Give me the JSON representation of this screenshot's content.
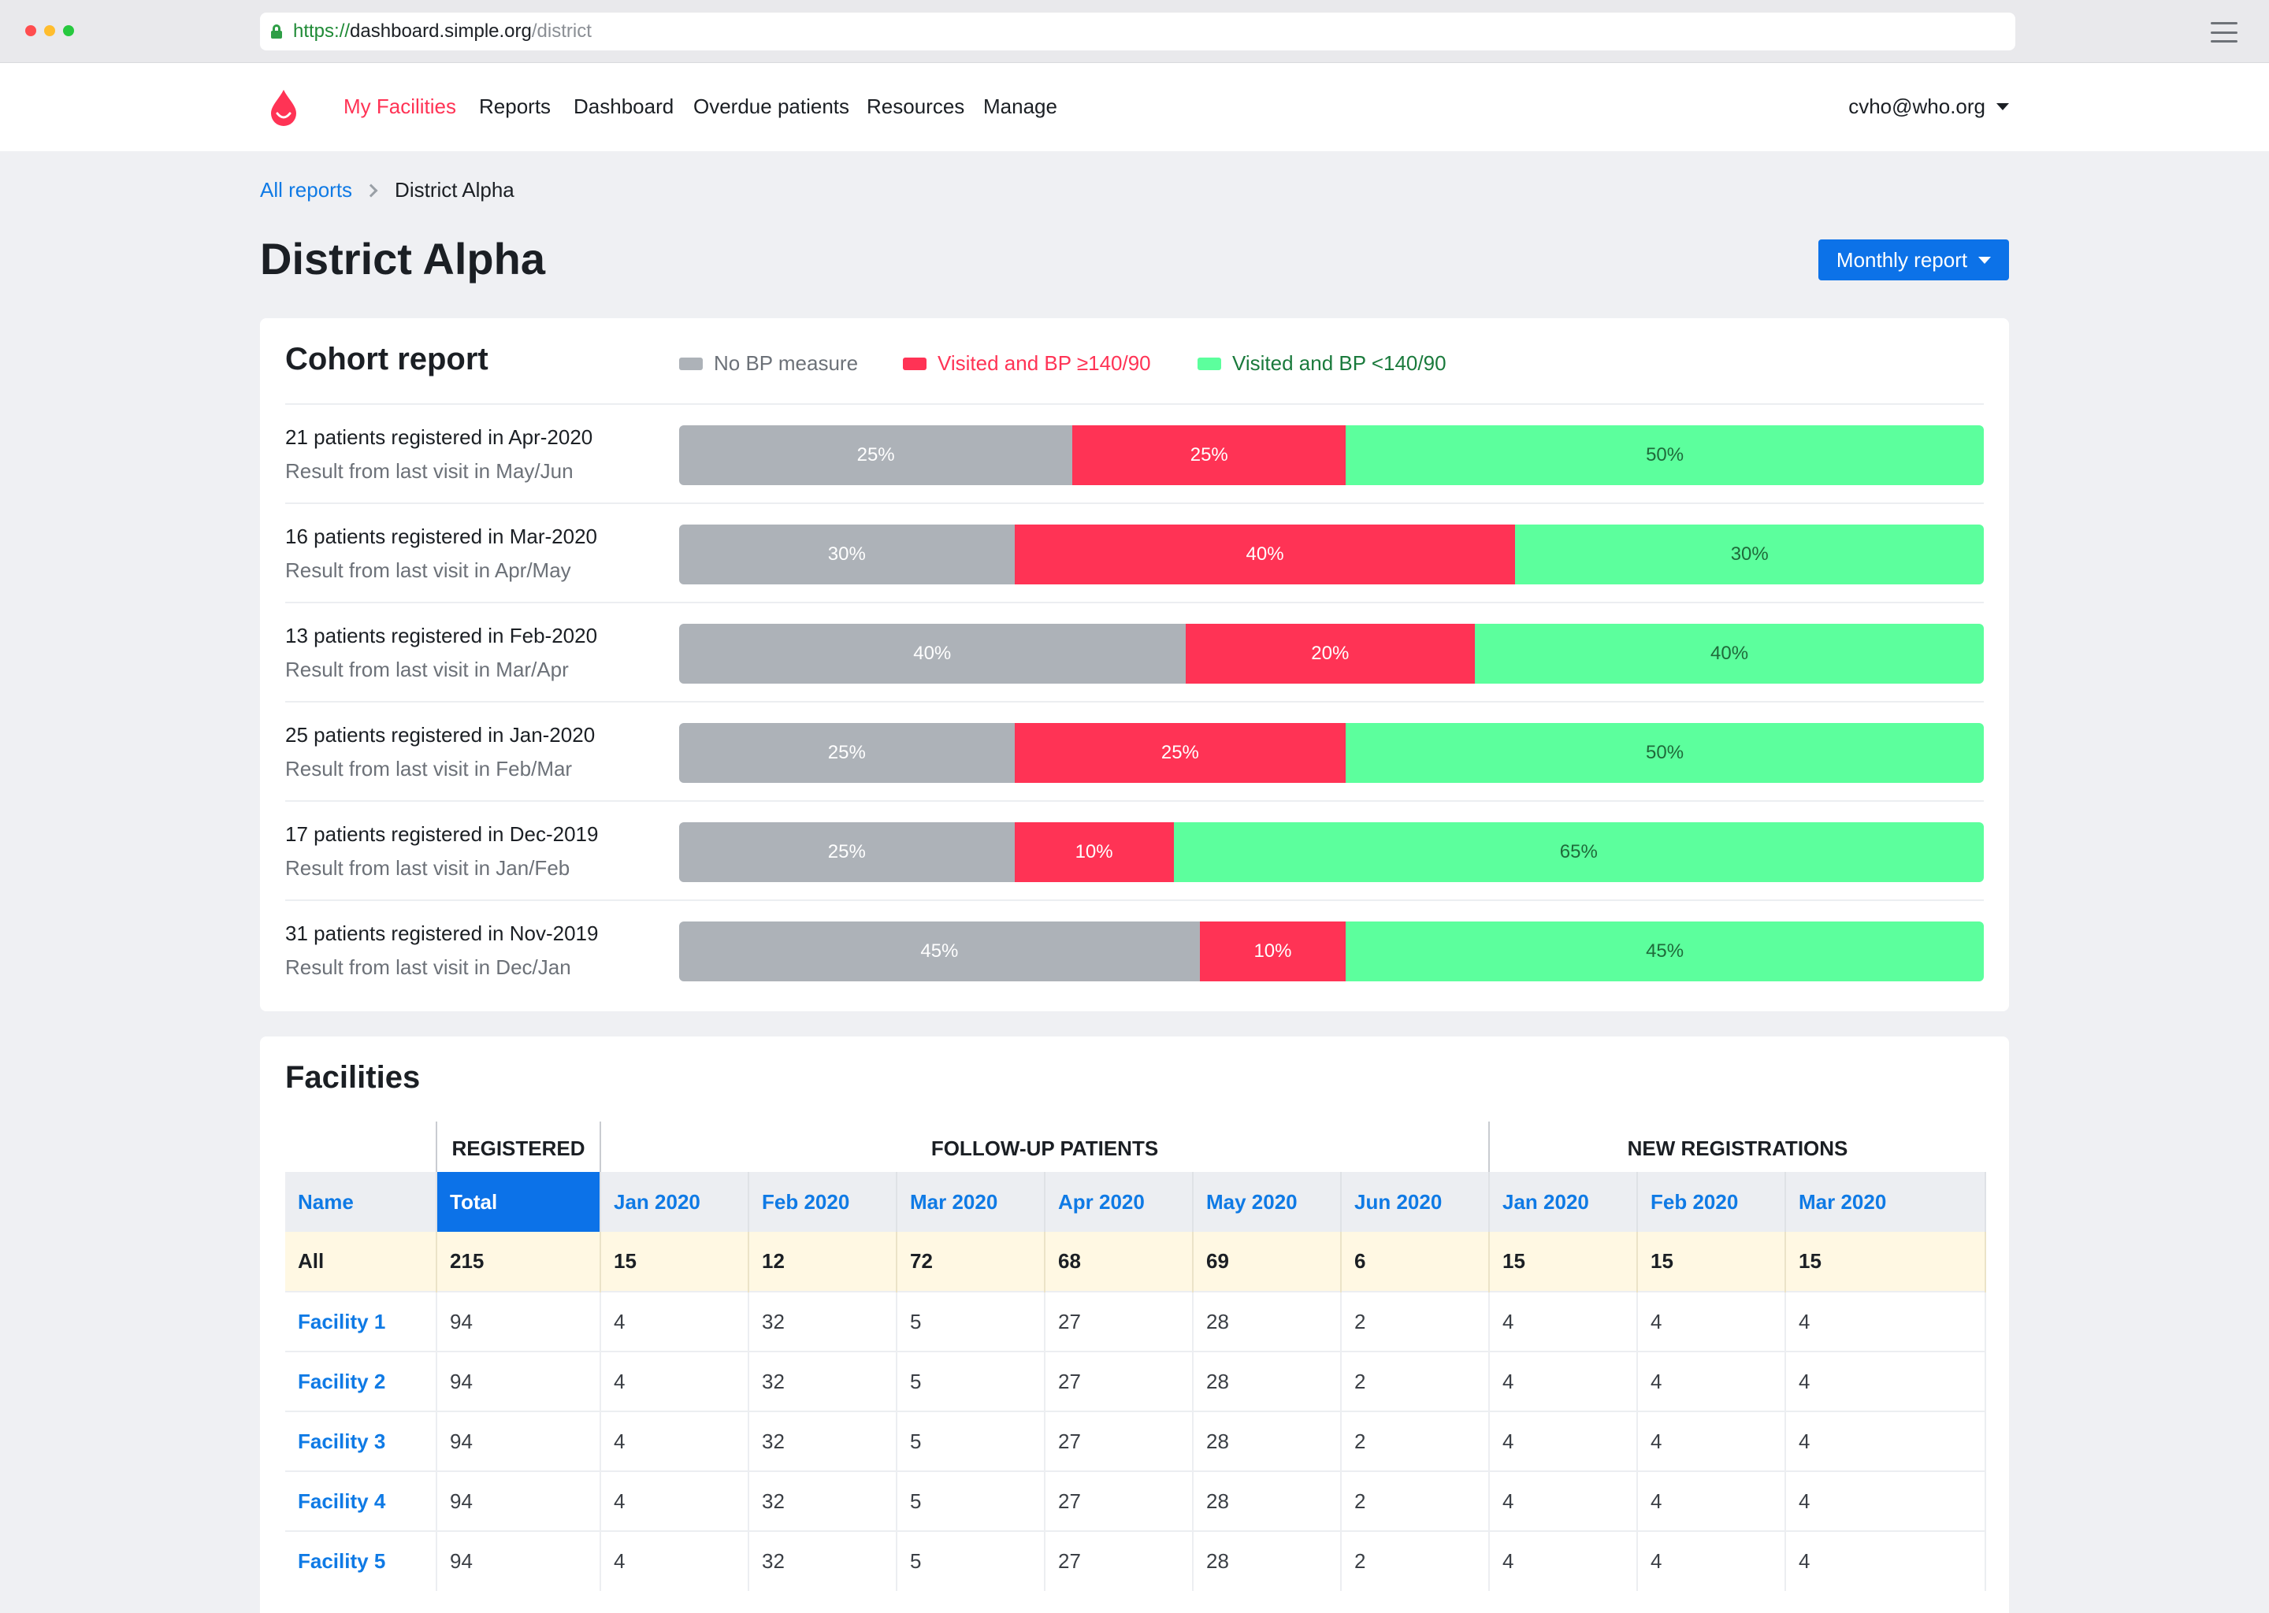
{
  "browser": {
    "url_scheme": "https://",
    "url_host": "dashboard.simple.org",
    "url_path": "/district"
  },
  "nav": {
    "items": [
      {
        "label": "My Facilities",
        "active": true
      },
      {
        "label": "Reports",
        "active": false
      },
      {
        "label": "Dashboard",
        "active": false
      },
      {
        "label": "Overdue patients",
        "active": false
      },
      {
        "label": "Resources",
        "active": false
      },
      {
        "label": "Manage",
        "active": false
      }
    ],
    "user": "cvho@who.org"
  },
  "breadcrumb": {
    "root": "All reports",
    "current": "District Alpha"
  },
  "page": {
    "title": "District Alpha",
    "report_button": "Monthly report"
  },
  "colors": {
    "no_bp": "#adb2b8",
    "uncontrolled": "#ff3355",
    "controlled": "#5cff9d",
    "primary": "#0c72e8",
    "link": "#0f7ae5"
  },
  "cohort": {
    "title": "Cohort report",
    "legend": {
      "no_bp": "No BP measure",
      "uncontrolled": "Visited and BP ≥140/90",
      "controlled": "Visited and BP <140/90"
    },
    "rows": [
      {
        "main": "21 patients registered in Apr-2020",
        "sub": "Result from last visit in May/Jun",
        "no_bp": "25%",
        "uncontrolled": "25%",
        "controlled": "50%"
      },
      {
        "main": "16 patients registered in Mar-2020",
        "sub": "Result from last visit in Apr/May",
        "no_bp": "30%",
        "uncontrolled": "40%",
        "controlled": "30%"
      },
      {
        "main": "13 patients registered in Feb-2020",
        "sub": "Result from last visit in Mar/Apr",
        "no_bp": "40%",
        "uncontrolled": "20%",
        "controlled": "40%"
      },
      {
        "main": "25 patients registered in Jan-2020",
        "sub": "Result from last visit in Feb/Mar",
        "no_bp": "25%",
        "uncontrolled": "25%",
        "controlled": "50%"
      },
      {
        "main": "17 patients registered in Dec-2019",
        "sub": "Result from last visit in Jan/Feb",
        "no_bp": "25%",
        "uncontrolled": "10%",
        "controlled": "65%"
      },
      {
        "main": "31 patients registered in Nov-2019",
        "sub": "Result from last visit in Dec/Jan",
        "no_bp": "45%",
        "uncontrolled": "10%",
        "controlled": "45%"
      }
    ]
  },
  "facilities": {
    "title": "Facilities",
    "groups": {
      "registered": "REGISTERED",
      "followup": "FOLLOW-UP PATIENTS",
      "new_reg": "NEW REGISTRATIONS"
    },
    "columns": [
      "Name",
      "Total",
      "Jan 2020",
      "Feb 2020",
      "Mar 2020",
      "Apr 2020",
      "May 2020",
      "Jun 2020",
      "Jan 2020",
      "Feb 2020",
      "Mar 2020"
    ],
    "total_row": [
      "All",
      "215",
      "15",
      "12",
      "72",
      "68",
      "69",
      "6",
      "15",
      "15",
      "15"
    ],
    "rows": [
      [
        "Facility 1",
        "94",
        "4",
        "32",
        "5",
        "27",
        "28",
        "2",
        "4",
        "4",
        "4"
      ],
      [
        "Facility 2",
        "94",
        "4",
        "32",
        "5",
        "27",
        "28",
        "2",
        "4",
        "4",
        "4"
      ],
      [
        "Facility 3",
        "94",
        "4",
        "32",
        "5",
        "27",
        "28",
        "2",
        "4",
        "4",
        "4"
      ],
      [
        "Facility 4",
        "94",
        "4",
        "32",
        "5",
        "27",
        "28",
        "2",
        "4",
        "4",
        "4"
      ],
      [
        "Facility 5",
        "94",
        "4",
        "32",
        "5",
        "27",
        "28",
        "2",
        "4",
        "4",
        "4"
      ]
    ]
  }
}
